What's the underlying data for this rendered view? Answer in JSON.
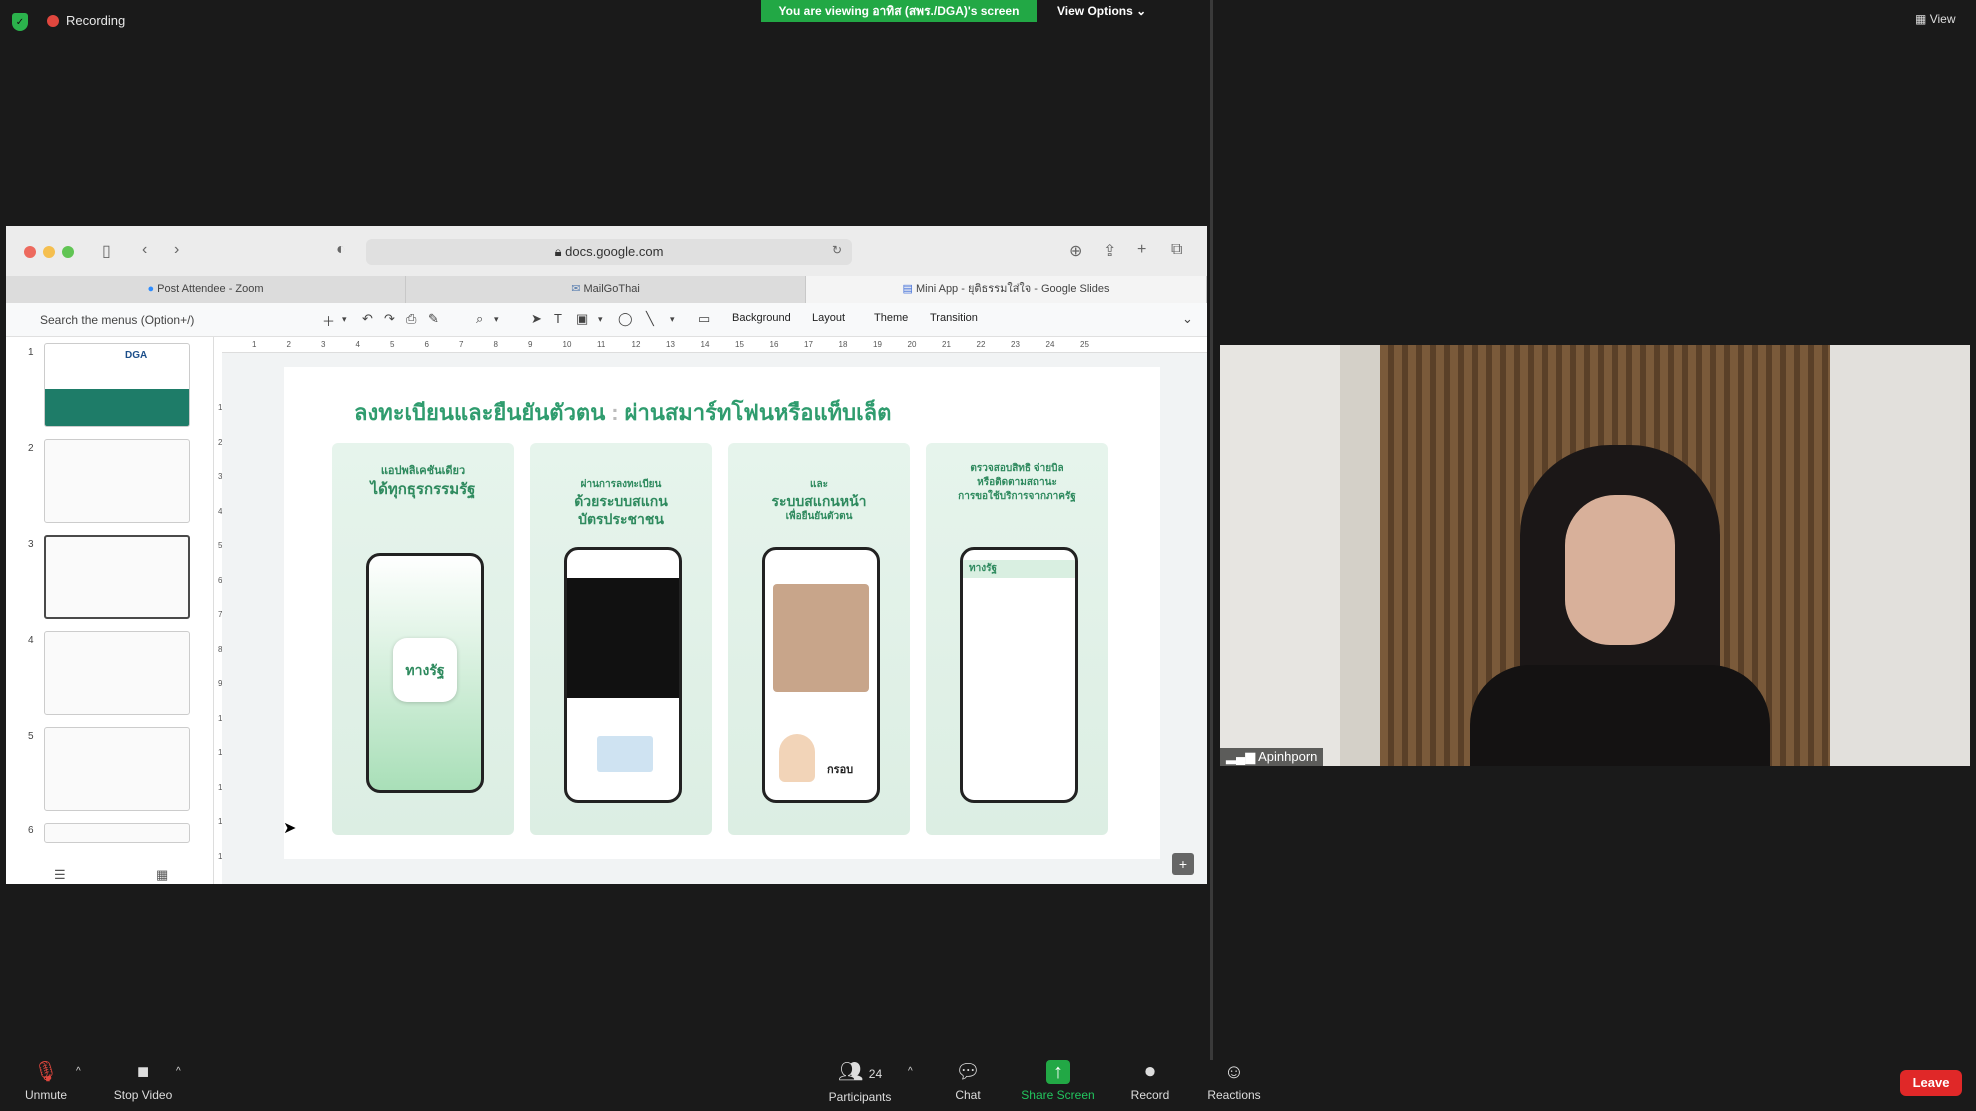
{
  "zoom_top": {
    "recording_label": "Recording",
    "viewing_banner": "You are viewing อาทิส (สพร./DGA)'s screen",
    "view_options": "View Options",
    "view_label": "View"
  },
  "browser": {
    "url": "docs.google.com",
    "tabs": [
      {
        "label": "Post Attendee - Zoom",
        "active": false
      },
      {
        "label": "MailGoThai",
        "active": false
      },
      {
        "label": "Mini App - ยุติธรรมใส่ใจ - Google Slides",
        "active": true
      }
    ]
  },
  "slides_toolbar": {
    "search_placeholder": "Search the menus (Option+/)",
    "background": "Background",
    "layout": "Layout",
    "theme": "Theme",
    "transition": "Transition"
  },
  "ruler": {
    "h": [
      "1",
      "2",
      "3",
      "4",
      "5",
      "6",
      "7",
      "8",
      "9",
      "10",
      "11",
      "12",
      "13",
      "14",
      "15",
      "16",
      "17",
      "18",
      "19",
      "20",
      "21",
      "22",
      "23",
      "24",
      "25"
    ],
    "v": [
      "1",
      "2",
      "3",
      "4",
      "5",
      "6",
      "7",
      "8",
      "9",
      "10",
      "11",
      "12",
      "13",
      "14"
    ]
  },
  "filmstrip": {
    "slides": [
      "1",
      "2",
      "3",
      "4",
      "5",
      "6"
    ],
    "selected": "3",
    "thumb1_text": "DGA"
  },
  "slide": {
    "title_left": "ลงทะเบียนและยืนยันตัวตน",
    "title_right": "ผ่านสมาร์ทโฟนหรือแท็บเล็ต",
    "cards": [
      {
        "cap1": "แอปพลิเคชันเดียว",
        "cap2": "ได้ทุกธุรกรรมรัฐ",
        "app_name": "ทางรัฐ"
      },
      {
        "cap1": "ผ่านการลงทะเบียน",
        "cap2": "ด้วยระบบสแกน",
        "cap3": "บัตรประชาชน"
      },
      {
        "cap1": "และ",
        "cap2": "ระบบสแกนหน้า",
        "cap3": "เพื่อยืนยันตัวตน",
        "inner": "กรอบ"
      },
      {
        "cap1": "ตรวจสอบสิทธิ จ่ายบิล",
        "cap2": "หรือติดตามสถานะ",
        "cap3": "การขอใช้บริการจากภาครัฐ",
        "app_name": "ทางรัฐ"
      }
    ]
  },
  "video": {
    "participant_name": "Apinhporn"
  },
  "bottom": {
    "unmute": "Unmute",
    "stop_video": "Stop Video",
    "participants": "Participants",
    "participant_count": "24",
    "chat": "Chat",
    "share_screen": "Share Screen",
    "record": "Record",
    "reactions": "Reactions",
    "leave": "Leave"
  },
  "colors": {
    "accent_green": "#22a845",
    "leave_red": "#e02828",
    "slide_green": "#2f9c6e"
  }
}
